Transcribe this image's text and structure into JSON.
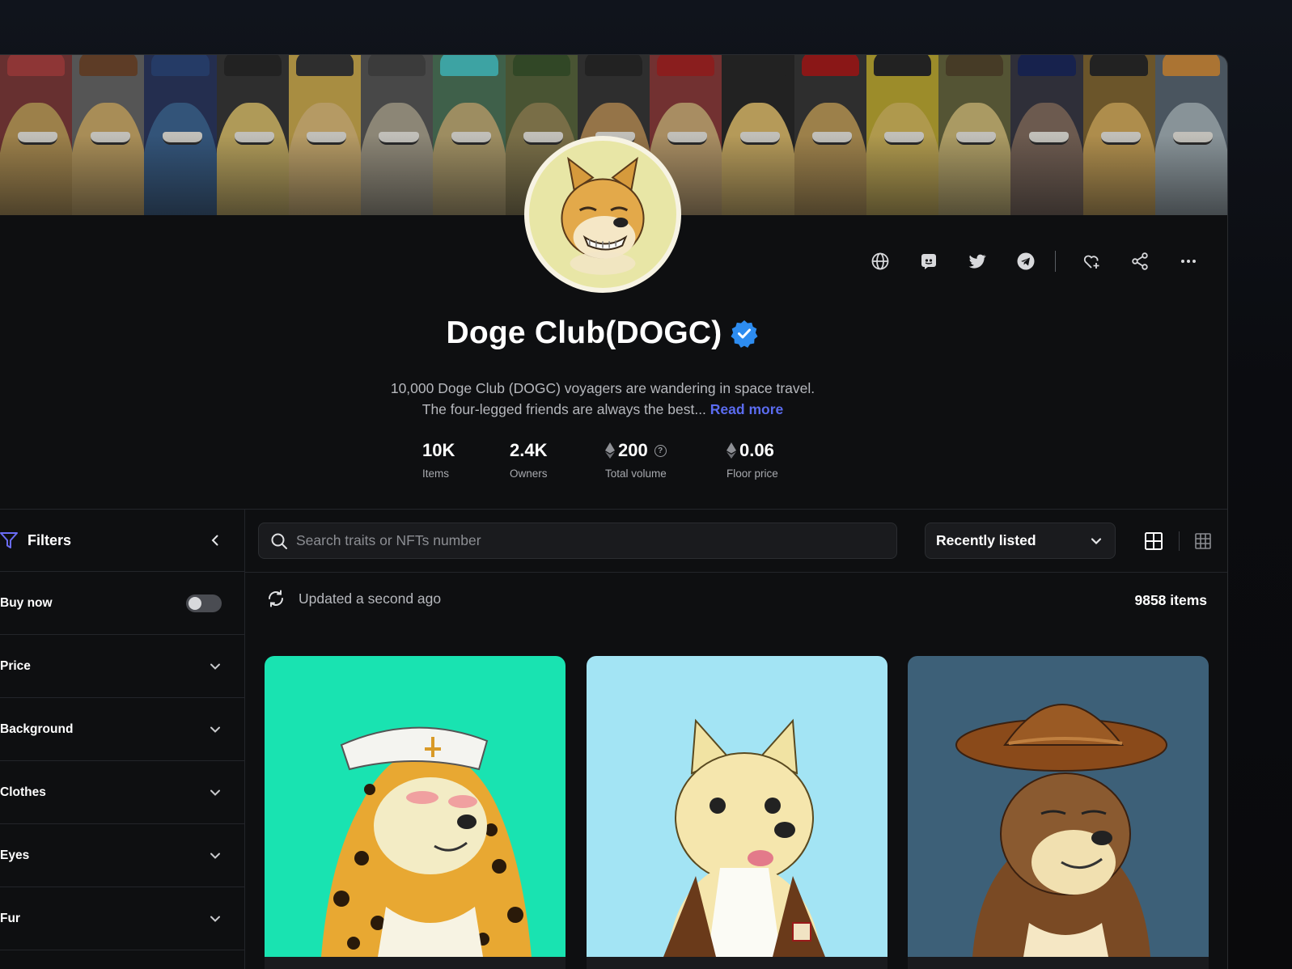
{
  "collection": {
    "title": "Doge Club(DOGC)",
    "description_line1": "10,000 Doge Club (DOGC) voyagers are wandering in space travel.",
    "description_line2": "The four-legged friends are always the best...",
    "read_more": "Read more"
  },
  "stats": [
    {
      "value": "10K",
      "label": "Items"
    },
    {
      "value": "2.4K",
      "label": "Owners"
    },
    {
      "value": "200",
      "label": "Total volume"
    },
    {
      "value": "0.06",
      "label": "Floor price"
    }
  ],
  "actions": [
    "globe-icon",
    "discord-icon",
    "twitter-icon",
    "telegram-icon",
    "heart-plus-icon",
    "share-icon",
    "more-icon"
  ],
  "filters": {
    "title": "Filters",
    "buy_now": "Buy now",
    "buy_now_enabled": false,
    "groups": [
      "Price",
      "Background",
      "Clothes",
      "Eyes",
      "Fur"
    ]
  },
  "search": {
    "placeholder": "Search traits or NFTs number"
  },
  "sort": {
    "selected": "Recently listed"
  },
  "status": {
    "updated": "Updated a second ago",
    "count": "9858 items"
  },
  "cards": [
    {
      "background": "#19e3b1"
    },
    {
      "background": "#a3e4f4"
    },
    {
      "background": "#3d6078"
    }
  ],
  "colors": {
    "accent": "#5b6cf0",
    "verified": "#2d8cf0",
    "filter_icon": "#6a6cf6"
  }
}
